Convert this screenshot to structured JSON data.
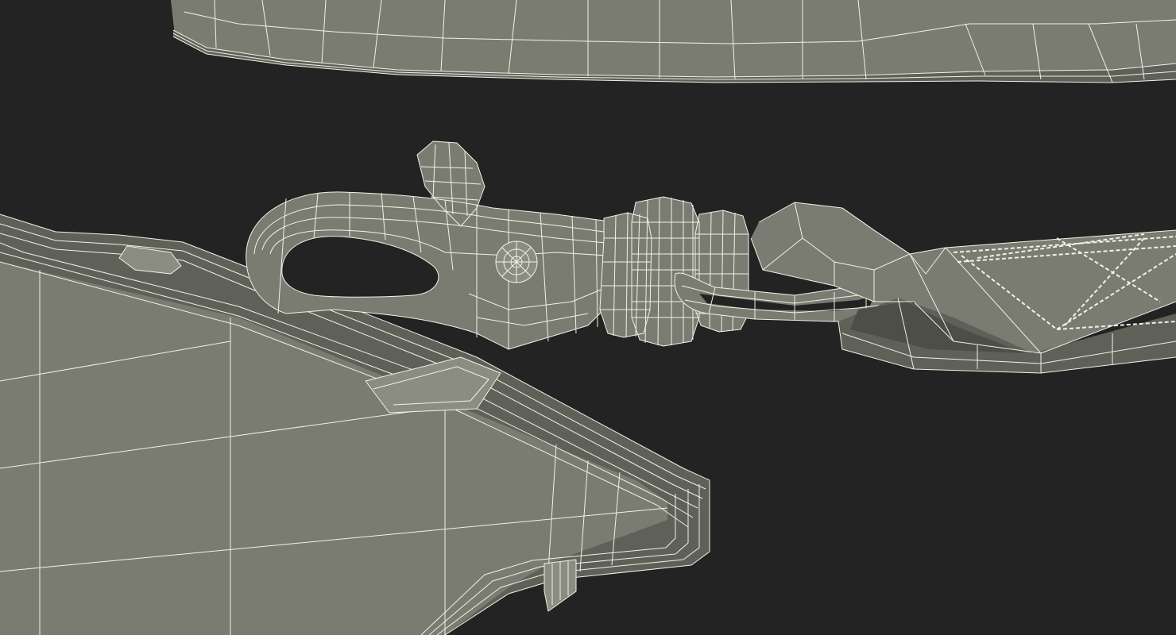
{
  "scene": {
    "background_color": "#232323",
    "surface_color": "#7b7c71",
    "surface_dark_color": "#5f6058",
    "surface_light_color": "#8c8d81",
    "wire_color": "#f2f1e6",
    "shadow_color": "#3a3a36"
  },
  "objects": [
    {
      "name": "lanyard-strap-top",
      "kind": "strap"
    },
    {
      "name": "id-badge-holder",
      "kind": "plate"
    },
    {
      "name": "snap-hook-clip",
      "kind": "hook"
    },
    {
      "name": "swivel-rings",
      "kind": "ring"
    },
    {
      "name": "d-ring-loop",
      "kind": "loop"
    },
    {
      "name": "stitched-strap-end",
      "kind": "strap"
    }
  ]
}
